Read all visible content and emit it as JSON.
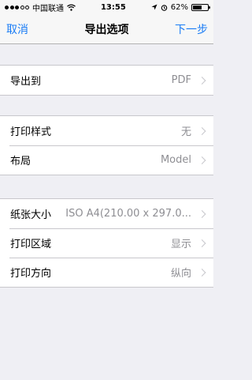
{
  "status_bar": {
    "carrier": "中国联通",
    "time": "13:55",
    "battery": "62%",
    "battery_level": 0.62,
    "signal_bars": 3
  },
  "nav": {
    "cancel": "取消",
    "title": "导出选项",
    "next": "下一步"
  },
  "groups": [
    {
      "rows": [
        {
          "label": "导出到",
          "value": "PDF"
        }
      ]
    },
    {
      "rows": [
        {
          "label": "打印样式",
          "value": "无"
        },
        {
          "label": "布局",
          "value": "Model"
        }
      ]
    },
    {
      "rows": [
        {
          "label": "纸张大小",
          "value": "ISO A4(210.00 x 297.0..."
        },
        {
          "label": "打印区域",
          "value": "显示"
        },
        {
          "label": "打印方向",
          "value": "纵向"
        }
      ]
    }
  ]
}
